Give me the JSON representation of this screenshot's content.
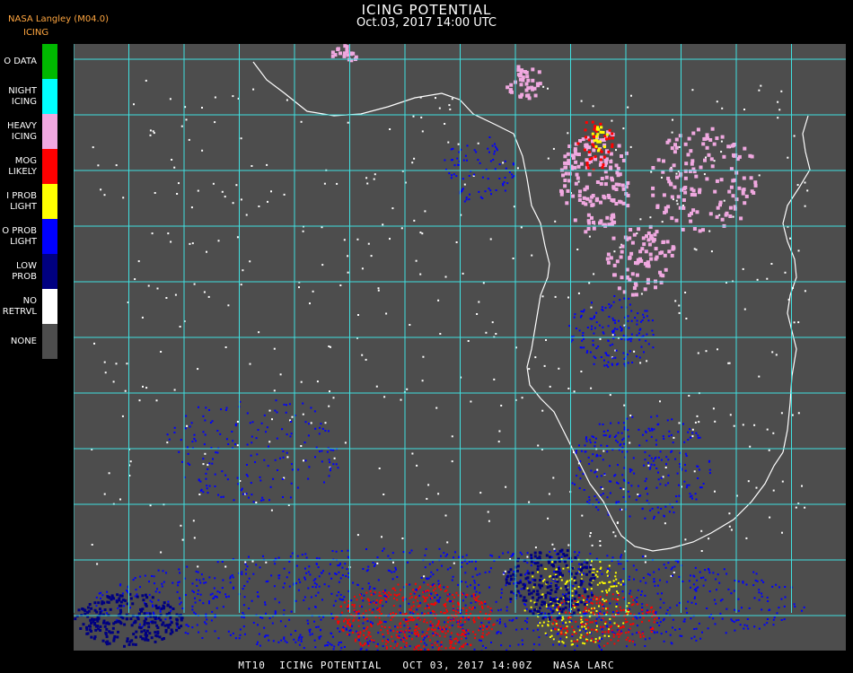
{
  "header": {
    "title": "ICING POTENTIAL",
    "datetime": "Oct.03, 2017 14:00 UTC",
    "org": "NASA Langley (M04.0)",
    "product": "ICING"
  },
  "legend": [
    {
      "lines": [
        "O DATA"
      ],
      "color": "#00b800"
    },
    {
      "lines": [
        "NIGHT",
        "ICING"
      ],
      "color": "#00ffff"
    },
    {
      "lines": [
        "HEAVY",
        "ICING"
      ],
      "color": "#f0a8e0"
    },
    {
      "lines": [
        "MOG",
        "LIKELY"
      ],
      "color": "#ff0000"
    },
    {
      "lines": [
        "I PROB",
        "LIGHT"
      ],
      "color": "#ffff00"
    },
    {
      "lines": [
        "O PROB",
        "LIGHT"
      ],
      "color": "#0000ff"
    },
    {
      "lines": [
        "LOW",
        "PROB"
      ],
      "color": "#000080"
    },
    {
      "lines": [
        "NO",
        "RETRVL"
      ],
      "color": "#ffffff"
    },
    {
      "lines": [
        "NONE"
      ],
      "color": "#4d4d4d"
    }
  ],
  "footer": "MT10  ICING POTENTIAL   OCT 03, 2017 14:00Z   NASA LARC",
  "colors": {
    "background": "#4d4d4d",
    "grid": "#40e0e0",
    "coast": "#ffffff",
    "grid_label": "#c02020"
  }
}
